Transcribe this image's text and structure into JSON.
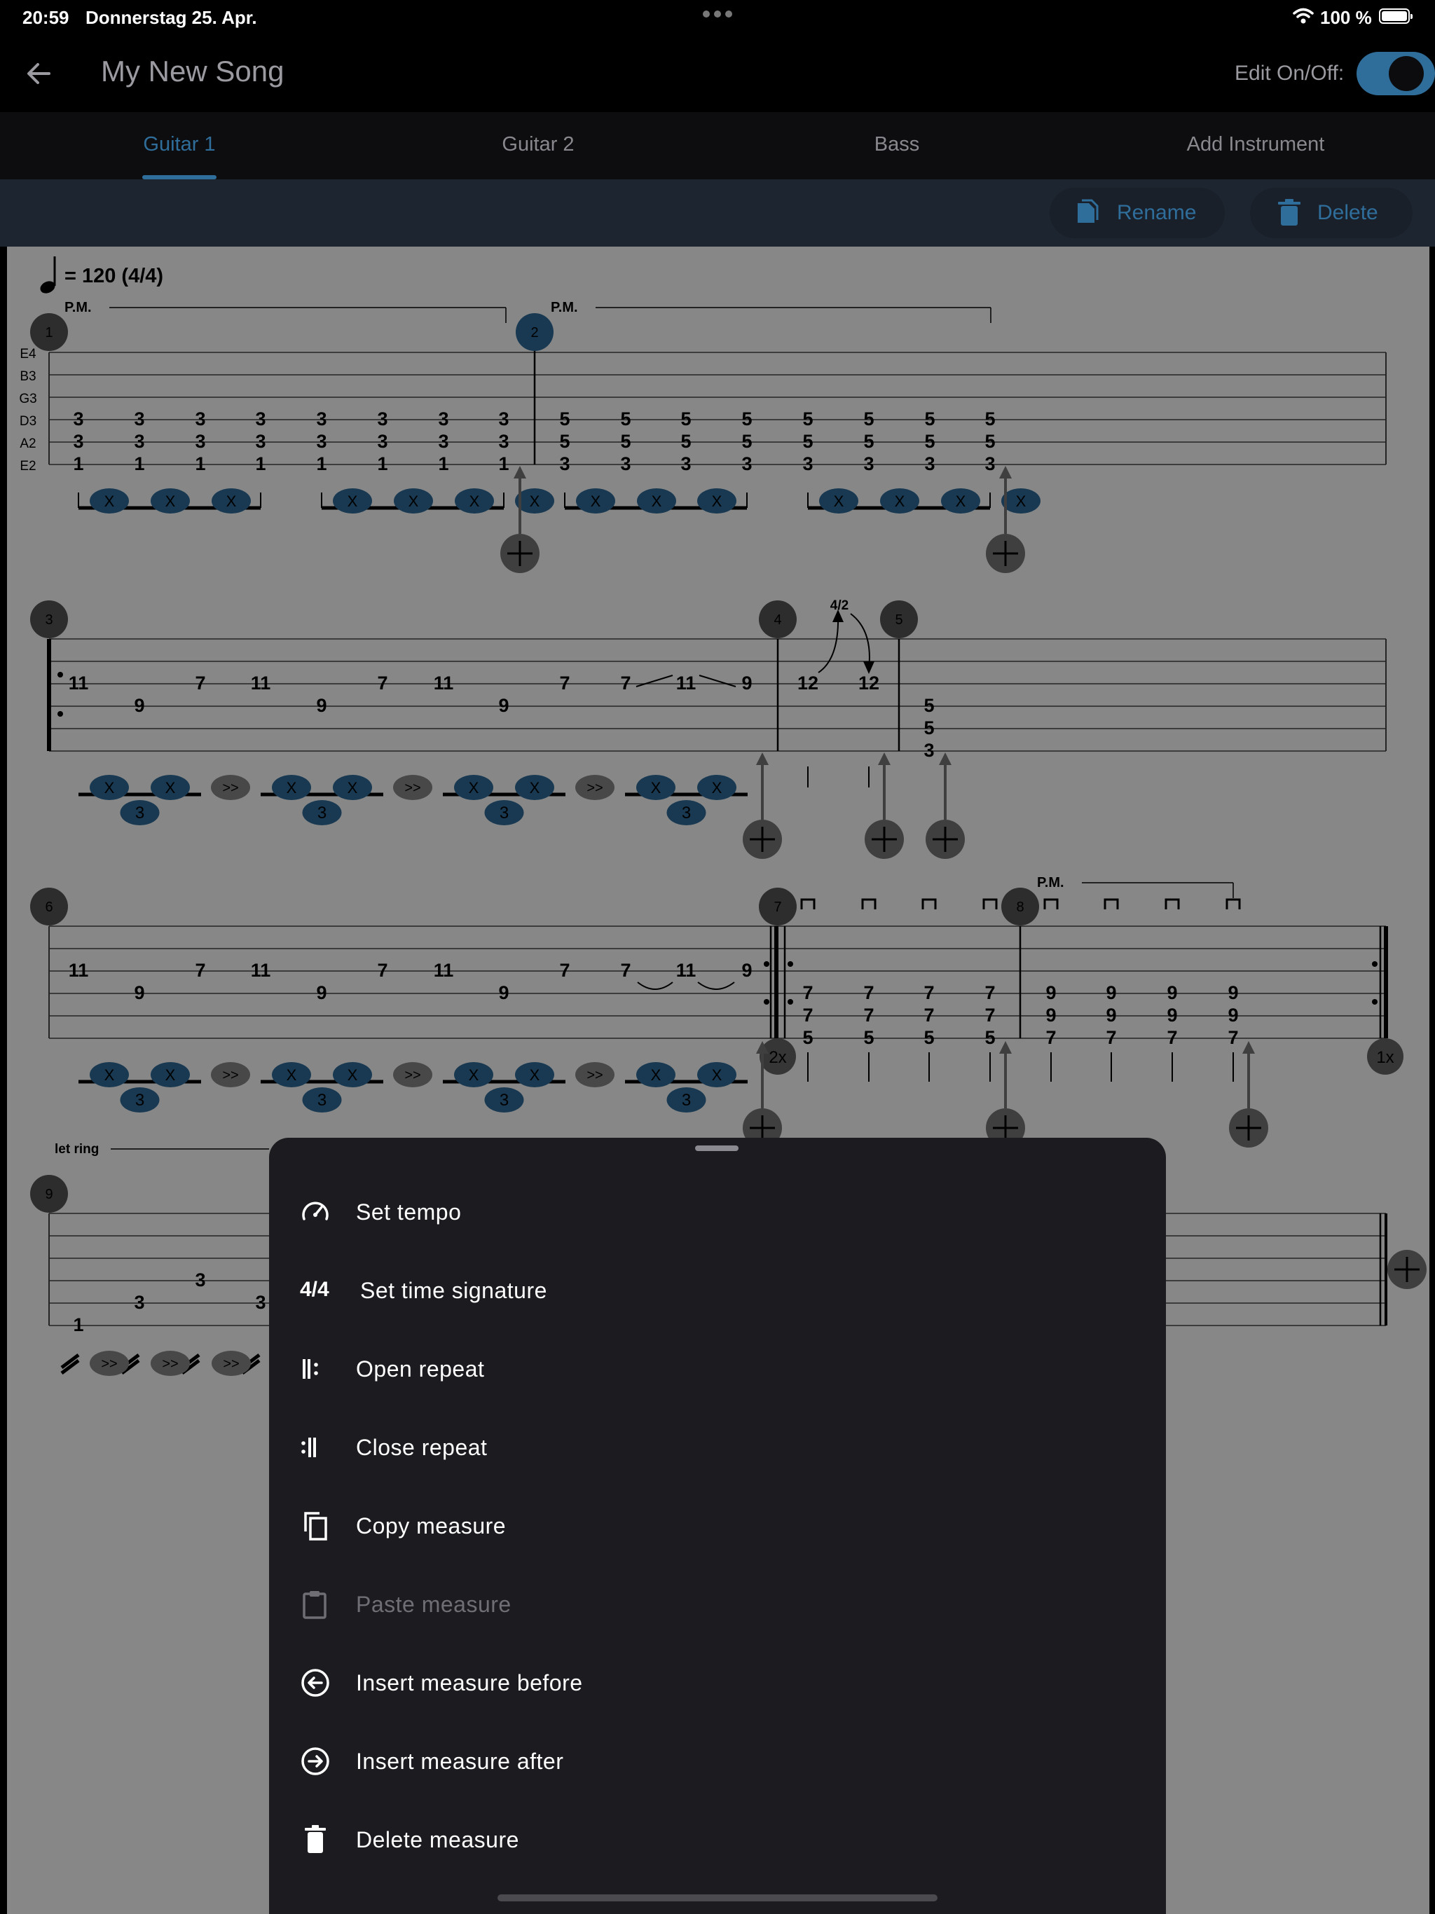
{
  "status": {
    "time": "20:59",
    "date": "Donnerstag 25. Apr.",
    "battery": "100 %"
  },
  "header": {
    "title": "My New Song",
    "edit_label": "Edit On/Off:",
    "edit_on": true
  },
  "tabs": [
    {
      "label": "Guitar 1",
      "active": true
    },
    {
      "label": "Guitar 2",
      "active": false
    },
    {
      "label": "Bass",
      "active": false
    },
    {
      "label": "Add Instrument",
      "active": false
    }
  ],
  "actions": {
    "rename": "Rename",
    "delete": "Delete"
  },
  "score": {
    "tempo": "= 120 (4/4)",
    "palm_mute": "P.M.",
    "let_ring": "let ring",
    "strings": [
      "E4",
      "B3",
      "G3",
      "D3",
      "A2",
      "E2"
    ],
    "bend": "4/2",
    "repeat_2x": "2x",
    "repeat_1x": "1x",
    "stroke_x": "X",
    "accent": ">>",
    "triplet": "3",
    "measure_numbers": [
      "1",
      "2",
      "3",
      "4",
      "5",
      "6",
      "7",
      "8",
      "9"
    ]
  },
  "colors": {
    "accent": "#2f6d9a",
    "sheet": "#1c1b20",
    "score_bg": "#ffffff"
  },
  "menu": [
    {
      "icon": "speedometer-icon",
      "label": "Set tempo",
      "enabled": true
    },
    {
      "icon_text": "4/4",
      "label": "Set time signature",
      "enabled": true
    },
    {
      "icon": "open-repeat-icon",
      "label": "Open repeat",
      "enabled": true
    },
    {
      "icon": "close-repeat-icon",
      "label": "Close repeat",
      "enabled": true
    },
    {
      "icon": "copy-icon",
      "label": "Copy measure",
      "enabled": true
    },
    {
      "icon": "clipboard-icon",
      "label": "Paste measure",
      "enabled": false
    },
    {
      "icon": "arrow-left-circle-icon",
      "label": "Insert measure before",
      "enabled": true
    },
    {
      "icon": "arrow-right-circle-icon",
      "label": "Insert measure after",
      "enabled": true
    },
    {
      "icon": "trash-icon",
      "label": "Delete measure",
      "enabled": true
    }
  ]
}
